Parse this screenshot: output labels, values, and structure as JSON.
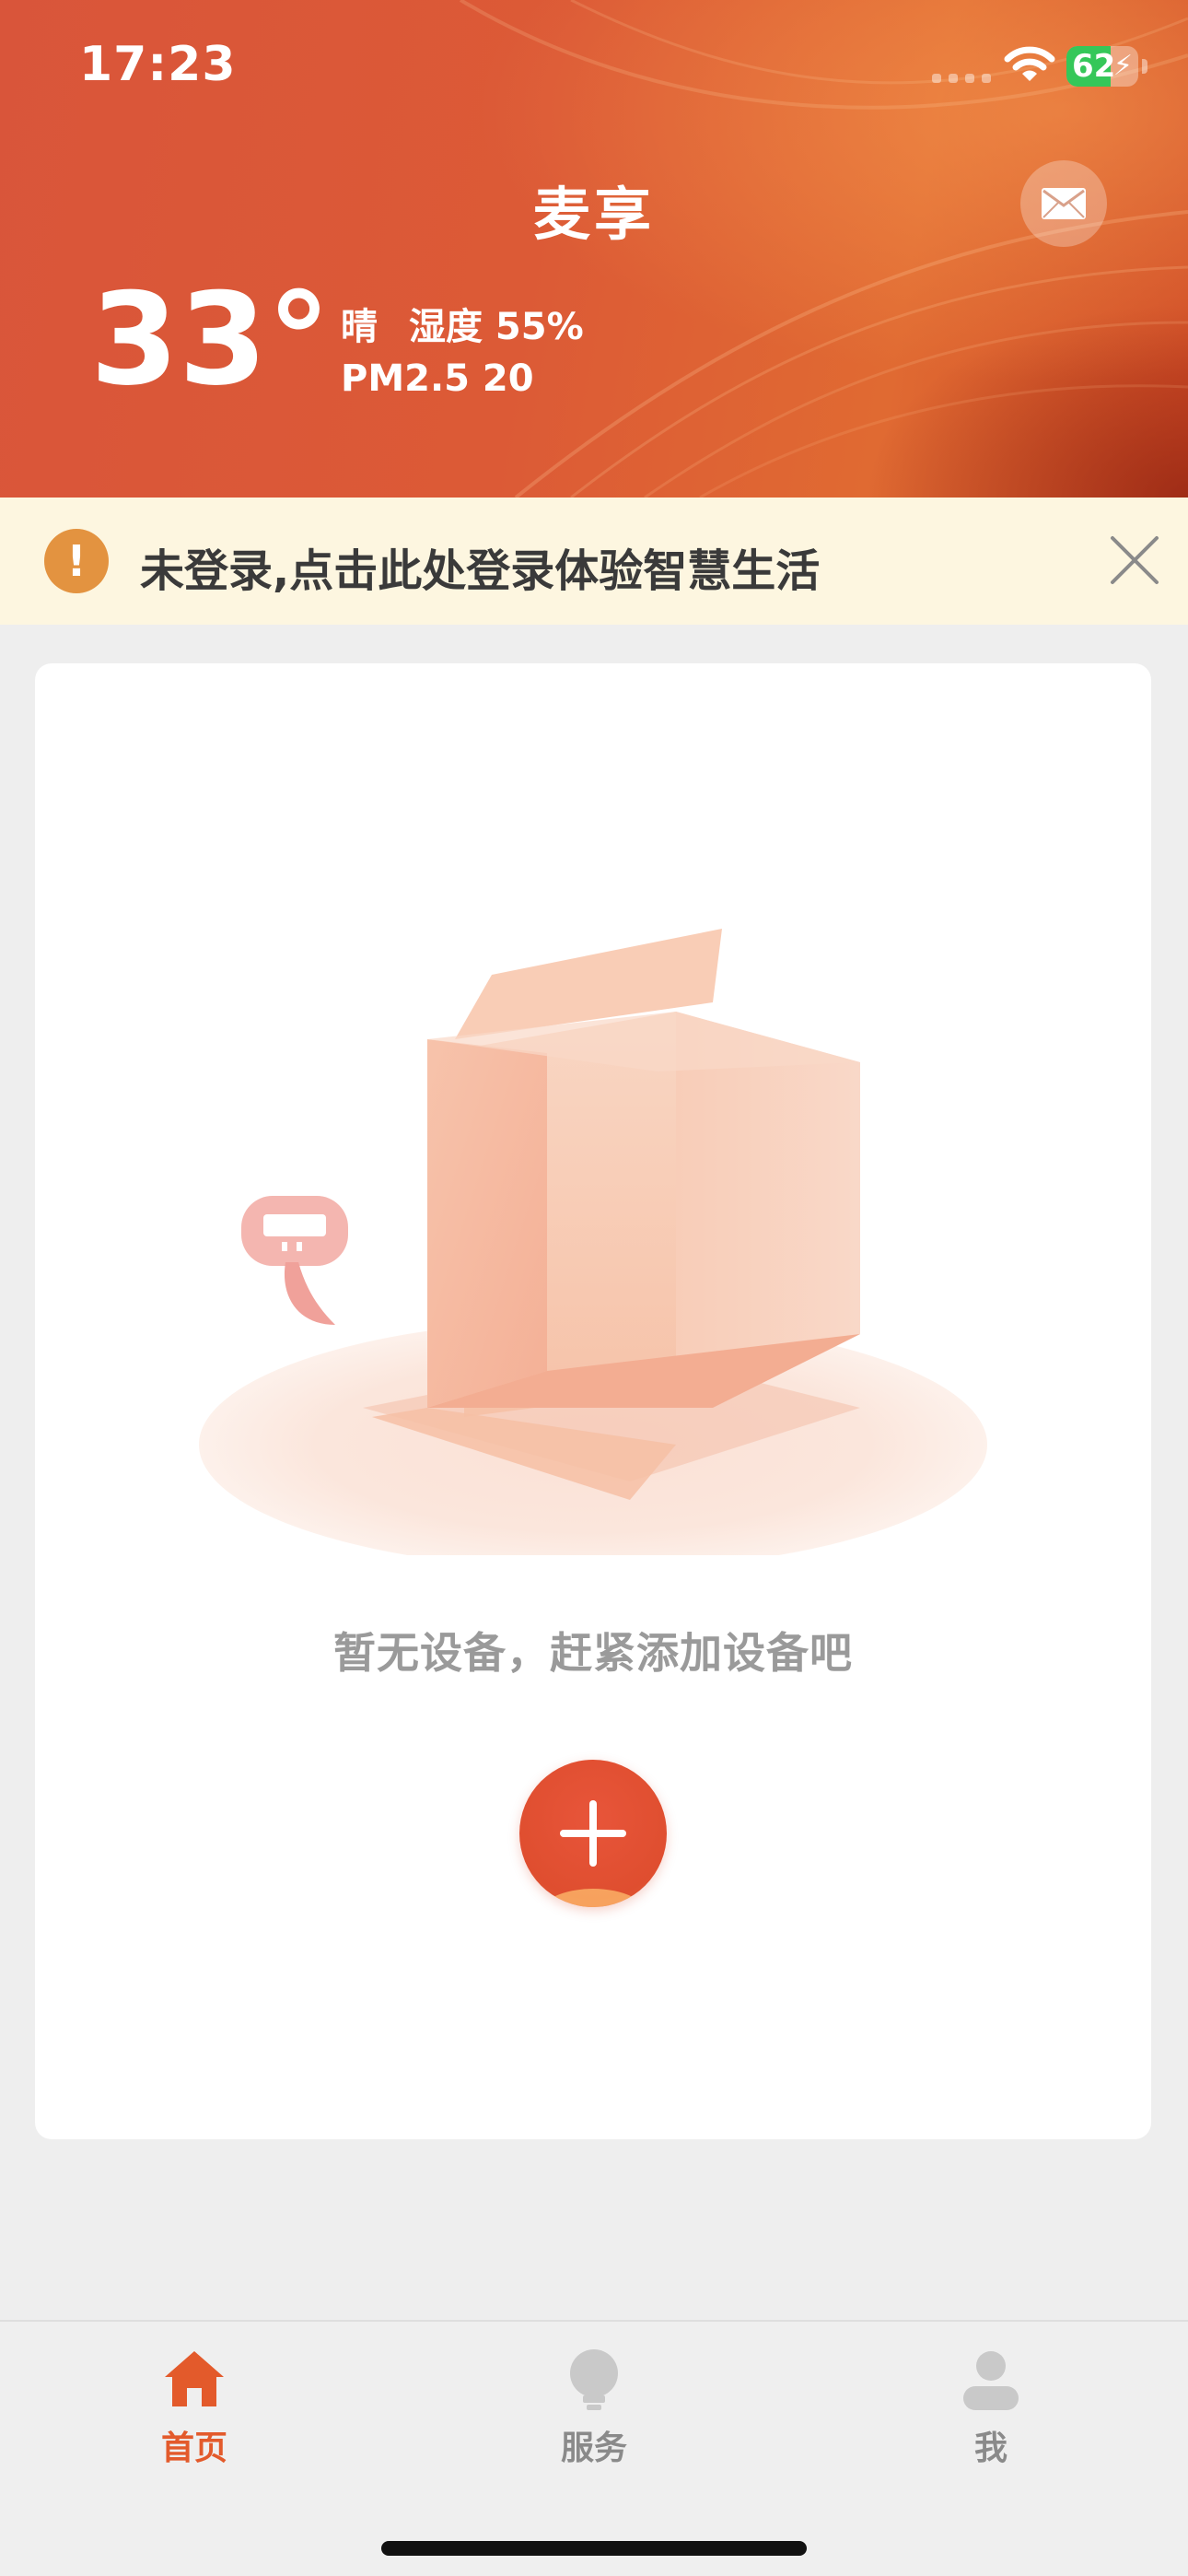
{
  "status_bar": {
    "time": "17:23",
    "battery_percent": "62",
    "battery_level": 0.62,
    "charging": true
  },
  "header": {
    "title": "麦享",
    "temperature": "33°",
    "weather": "晴",
    "humidity": "湿度 55%",
    "pm25": "PM2.5 20",
    "mail_icon": "mail-icon"
  },
  "login_banner": {
    "text": "未登录,点击此处登录体验智慧生活",
    "warning_icon": "warning-icon",
    "warning_symbol": "!",
    "close_icon": "close-icon"
  },
  "empty_state": {
    "message": "暂无设备，赶紧添加设备吧",
    "illustration": "empty-box-illustration",
    "add_icon": "plus-icon"
  },
  "tabs": [
    {
      "label": "首页",
      "icon": "home-icon",
      "active": true
    },
    {
      "label": "服务",
      "icon": "lightbulb-icon",
      "active": false
    },
    {
      "label": "我",
      "icon": "person-icon",
      "active": false
    }
  ],
  "colors": {
    "accent": "#e35a2b",
    "header": "#dc5a36",
    "banner_bg": "#fdf6e0",
    "warning": "#e39340",
    "inactive": "#8a8a8a"
  }
}
